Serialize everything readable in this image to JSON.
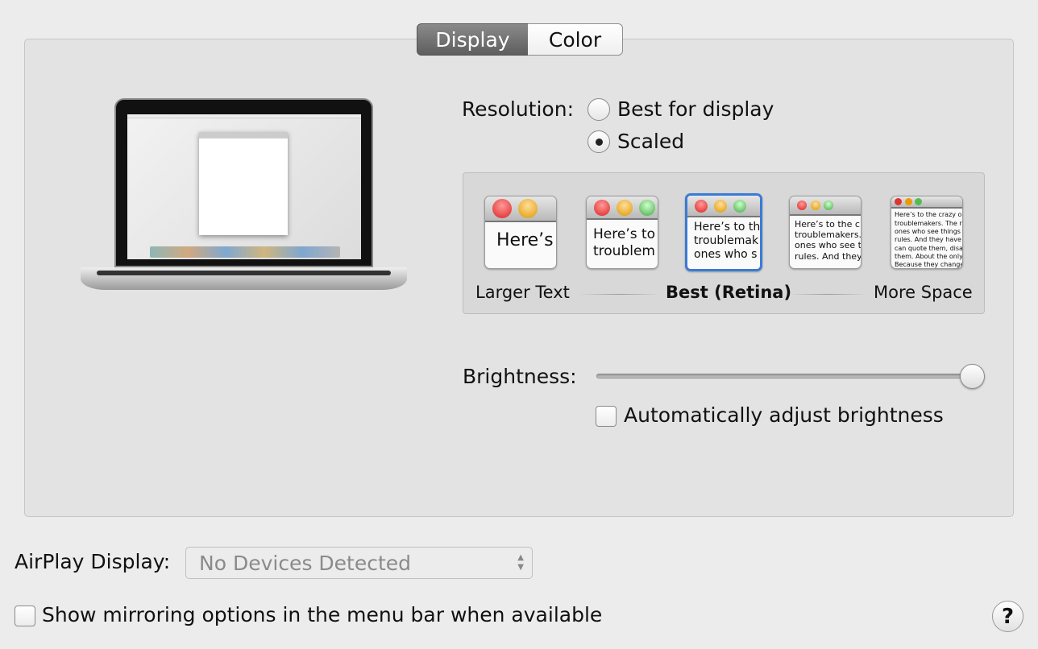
{
  "tabs": [
    {
      "label": "Display",
      "selected": true
    },
    {
      "label": "Color",
      "selected": false
    }
  ],
  "resolution": {
    "label": "Resolution:",
    "options": [
      {
        "label": "Best for display",
        "selected": false
      },
      {
        "label": "Scaled",
        "selected": true
      }
    ]
  },
  "scaled": {
    "thumbs": [
      {
        "text": "Here’s"
      },
      {
        "text": "Here’s to\ntroublem"
      },
      {
        "text": "Here’s to th\ntroublemak\nones who s",
        "selected": true
      },
      {
        "text": "Here’s to the cr\ntroublemakers.\nones who see t\nrules. And they"
      },
      {
        "text": "Here’s to the crazy ones\ntroublemakers. The rou\nones who see things di\nrules. And they have no\ncan quote them, disagre\nthem. About the only th\nBecause they change th"
      }
    ],
    "left_label": "Larger Text",
    "center_label": "Best (Retina)",
    "right_label": "More Space"
  },
  "brightness": {
    "label": "Brightness:",
    "value_percent": 100,
    "auto_label": "Automatically adjust brightness",
    "auto_checked": false
  },
  "airplay": {
    "label": "AirPlay Display:",
    "value": "No Devices Detected"
  },
  "mirroring": {
    "label": "Show mirroring options in the menu bar when available",
    "checked": false
  },
  "help": {
    "label": "?"
  },
  "colors": {
    "selection": "#3a7bd5",
    "panel": "#e3e3e3"
  }
}
